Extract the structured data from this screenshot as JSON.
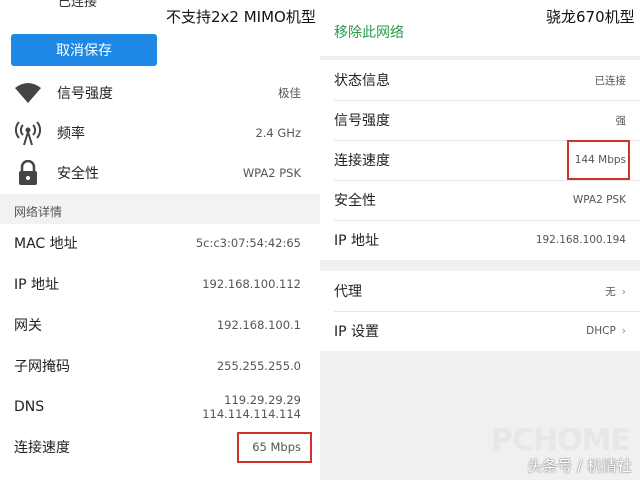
{
  "left": {
    "partial_top_text": "已连接",
    "caption": "不支持2x2 MIMO机型",
    "cancel_save_label": "取消保存",
    "rows": [
      {
        "label": "信号强度",
        "value": "极佳",
        "icon": "wifi-icon"
      },
      {
        "label": "频率",
        "value": "2.4 GHz",
        "icon": "antenna-icon"
      },
      {
        "label": "安全性",
        "value": "WPA2 PSK",
        "icon": "lock-icon"
      }
    ],
    "section_header": "网络详情",
    "details": [
      {
        "label": "MAC 地址",
        "value": "5c:c3:07:54:42:65"
      },
      {
        "label": "IP 地址",
        "value": "192.168.100.112"
      },
      {
        "label": "网关",
        "value": "192.168.100.1"
      },
      {
        "label": "子网掩码",
        "value": "255.255.255.0"
      },
      {
        "label": "DNS",
        "value": "119.29.29.29",
        "value2": "114.114.114.114"
      },
      {
        "label": "连接速度",
        "value": "65 Mbps"
      }
    ]
  },
  "right": {
    "forget_label": "移除此网络",
    "caption": "骁龙670机型",
    "status_rows": [
      {
        "label": "状态信息",
        "value": "已连接"
      },
      {
        "label": "信号强度",
        "value": "强"
      },
      {
        "label": "连接速度",
        "value": "144 Mbps"
      },
      {
        "label": "安全性",
        "value": "WPA2 PSK"
      },
      {
        "label": "IP 地址",
        "value": "192.168.100.194"
      }
    ],
    "settings_rows": [
      {
        "label": "代理",
        "value": "无",
        "chevron": "›"
      },
      {
        "label": "IP 设置",
        "value": "DHCP",
        "chevron": "›"
      }
    ]
  },
  "watermark": {
    "text": "头条号 / 机情社",
    "logo": "PCHOME"
  },
  "colors": {
    "primary_button": "#1e88e5",
    "forget_text": "#2c9a4a",
    "highlight_box": "#d0312d"
  }
}
